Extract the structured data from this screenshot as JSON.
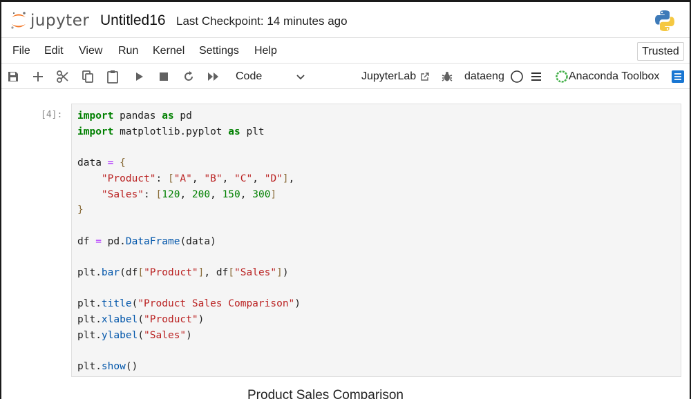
{
  "app": {
    "logo_text": "jupyter",
    "notebook_title": "Untitled16",
    "checkpoint_text": "Last Checkpoint: 14 minutes ago"
  },
  "menu": {
    "items": [
      "File",
      "Edit",
      "View",
      "Run",
      "Kernel",
      "Settings",
      "Help"
    ],
    "trusted_label": "Trusted"
  },
  "toolbar": {
    "cell_type": "Code",
    "jupyterlab_label": "JupyterLab",
    "kernel_name": "dataeng",
    "toolbox_label": "Anaconda Toolbox",
    "icons": [
      "save-icon",
      "add-icon",
      "cut-icon",
      "copy-icon",
      "paste-icon",
      "run-icon",
      "stop-icon",
      "restart-icon",
      "fast-forward-icon"
    ]
  },
  "cell": {
    "prompt": "[4]:",
    "code_lines": [
      "import pandas as pd",
      "import matplotlib.pyplot as plt",
      "",
      "data = {",
      "    \"Product\": [\"A\", \"B\", \"C\", \"D\"],",
      "    \"Sales\": [120, 200, 150, 300]",
      "}",
      "",
      "df = pd.DataFrame(data)",
      "",
      "plt.bar(df[\"Product\"], df[\"Sales\"])",
      "",
      "plt.title(\"Product Sales Comparison\")",
      "plt.xlabel(\"Product\")",
      "plt.ylabel(\"Sales\")",
      "",
      "plt.show()"
    ]
  },
  "output": {
    "chart_title": "Product Sales Comparison"
  },
  "colors": {
    "keyword": "#008000",
    "string": "#ba2121",
    "operator": "#aa22ff",
    "function": "#0055aa",
    "accent": "#1976d2",
    "jupyter_orange": "#f37726"
  }
}
